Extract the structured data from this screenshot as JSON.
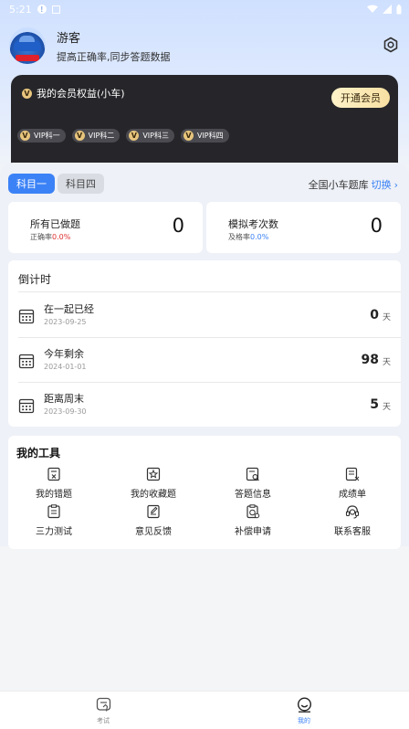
{
  "status_bar": {
    "time": "5:21"
  },
  "profile": {
    "name": "游客",
    "subtitle": "提高正确率,同步答题数据"
  },
  "vip": {
    "title": "我的会员权益(小车)",
    "open_button": "开通会员",
    "coin_letter": "V",
    "badges": [
      {
        "label": "VIP科一"
      },
      {
        "label": "VIP科二"
      },
      {
        "label": "VIP科三"
      },
      {
        "label": "VIP科四"
      }
    ]
  },
  "subjects": {
    "tabs": [
      {
        "label": "科目一",
        "active": true
      },
      {
        "label": "科目四",
        "active": false
      }
    ],
    "bank_label": "全国小车题库",
    "bank_switch": "切换",
    "bank_chevron": "›"
  },
  "stats": [
    {
      "label": "所有已做题",
      "sub_label": "正确率",
      "sub_value": "0.0%",
      "value": "0"
    },
    {
      "label": "模拟考次数",
      "sub_label": "及格率",
      "sub_value": "0.0%",
      "value": "0"
    }
  ],
  "countdown": {
    "title": "倒计时",
    "unit": "天",
    "rows": [
      {
        "name": "在一起已经",
        "date": "2023-09-25",
        "value": "0"
      },
      {
        "name": "今年剩余",
        "date": "2024-01-01",
        "value": "98"
      },
      {
        "name": "距离周末",
        "date": "2023-09-30",
        "value": "5"
      }
    ]
  },
  "tools": {
    "title": "我的工具",
    "items": [
      {
        "label": "我的错题",
        "icon": "wrong-questions-icon"
      },
      {
        "label": "我的收藏题",
        "icon": "favorites-icon"
      },
      {
        "label": "答题信息",
        "icon": "answer-info-icon"
      },
      {
        "label": "成绩单",
        "icon": "transcript-icon"
      },
      {
        "label": "三力测试",
        "icon": "three-ability-test-icon"
      },
      {
        "label": "意见反馈",
        "icon": "feedback-icon"
      },
      {
        "label": "补偿申请",
        "icon": "compensation-icon"
      },
      {
        "label": "联系客服",
        "icon": "customer-service-icon"
      }
    ]
  },
  "bottom_nav": [
    {
      "label": "考试",
      "active": false
    },
    {
      "label": "我的",
      "active": true
    }
  ],
  "colors": {
    "accent": "#3b82f6",
    "vip_dark": "#26262a",
    "vip_gold": "#f7dfa2",
    "red": "#e03131"
  }
}
